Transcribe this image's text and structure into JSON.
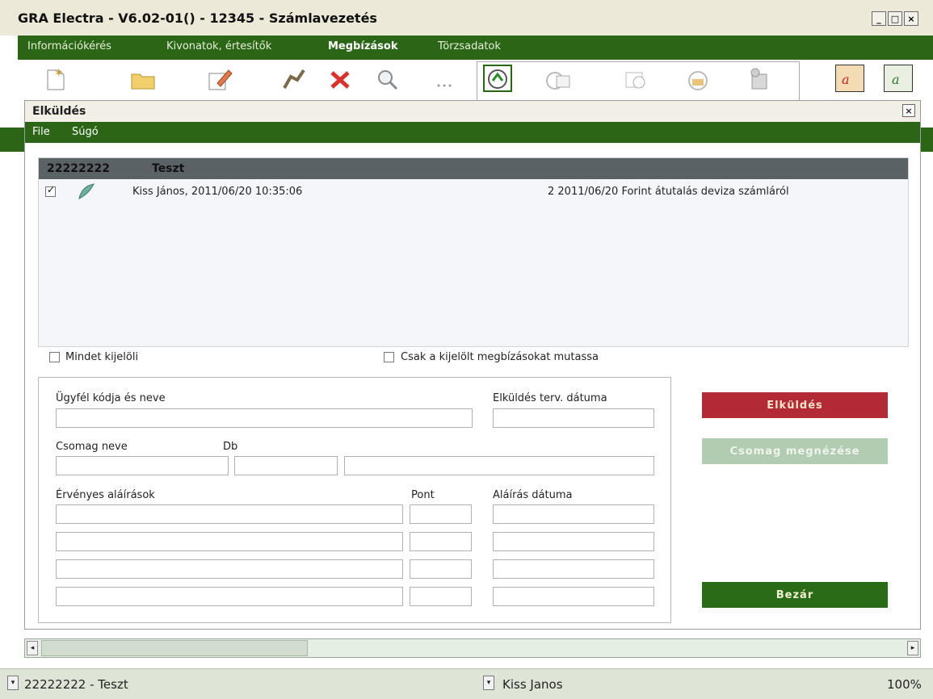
{
  "window": {
    "title": "GRA Electra - V6.02-01() - 12345 - Számlavezetés",
    "controls": [
      "_",
      "□",
      "×"
    ]
  },
  "menubar": {
    "items": [
      "Információkérés",
      "Kivonatok, értesítők",
      "Megbízások",
      "Törzsadatok"
    ],
    "active": "Megbízások"
  },
  "toolbar": {
    "icons": [
      "new-document-icon",
      "open-folder-icon",
      "edit-pencil-icon",
      "sign-hand-icon",
      "delete-x-icon",
      "search-magnifier-icon",
      "more-icon",
      "send-icon",
      "print-icon",
      "refresh-icon",
      "package-icon",
      "database-icon",
      "red-signature-icon",
      "green-signature-icon"
    ]
  },
  "dialog": {
    "title": "Elküldés",
    "menu": {
      "file": "File",
      "help": "Súgó"
    },
    "list": {
      "header_code": "22222222",
      "header_name": "Teszt",
      "rows": [
        {
          "checked": true,
          "signer": "Kiss János, 2011/06/20 10:35:06",
          "detail": "2 2011/06/20  Forint átutalás deviza számláról"
        }
      ]
    },
    "select_all_label": "Mindet kijelöli",
    "show_selected_label": "Csak a kijelölt megbízásokat mutassa",
    "form": {
      "client_label": "Ügyfél kódja és neve",
      "send_date_label": "Elküldés terv. dátuma",
      "package_label": "Csomag neve",
      "count_label": "Db",
      "signatures_label": "Érvényes aláírások",
      "points_label": "Pont",
      "sign_date_label": "Aláírás dátuma"
    },
    "buttons": {
      "send": "Elküldés",
      "view_package": "Csomag megnézése",
      "close": "Bezár"
    }
  },
  "statusbar": {
    "account": "22222222 - Teszt",
    "user": "Kiss Janos",
    "zoom": "100%"
  },
  "colors": {
    "brand_green": "#2b6617",
    "send_red": "#b22a36",
    "disabled_green": "#b2ccb1"
  }
}
